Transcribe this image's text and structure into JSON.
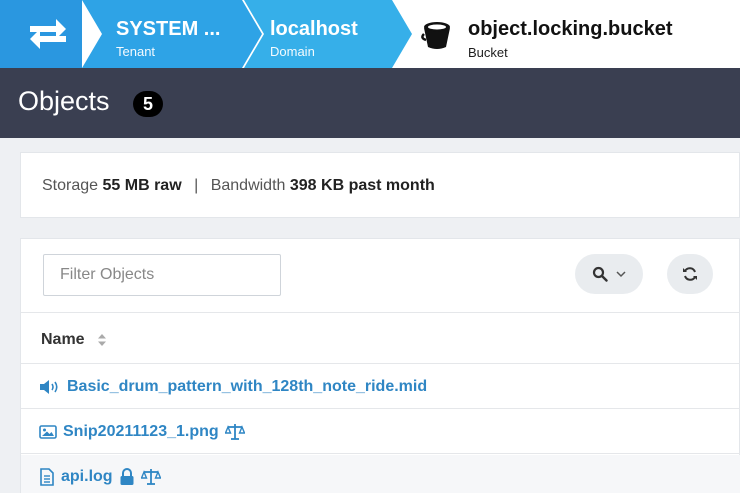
{
  "breadcrumb": {
    "tenant": {
      "title": "SYSTEM ...",
      "sub": "Tenant"
    },
    "domain": {
      "title": "localhost",
      "sub": "Domain"
    },
    "bucket": {
      "title": "object.locking.bucket",
      "sub": "Bucket"
    }
  },
  "header": {
    "title": "Objects",
    "count": "5"
  },
  "stats": {
    "storage_label": "Storage",
    "storage_value": "55 MB raw",
    "separator": "|",
    "bandwidth_label": "Bandwidth",
    "bandwidth_value": "398 KB past month"
  },
  "objects_panel": {
    "filter_placeholder": "Filter Objects",
    "column_name": "Name",
    "rows": [
      {
        "name": "Basic_drum_pattern_with_128th_note_ride.mid",
        "icon": "audio-icon",
        "badges": []
      },
      {
        "name": "Snip20211123_1.png",
        "icon": "image-icon",
        "badges": [
          "legal-hold-icon"
        ]
      },
      {
        "name": "api.log",
        "icon": "file-text-icon",
        "badges": [
          "lock-icon",
          "legal-hold-icon"
        ]
      }
    ]
  },
  "colors": {
    "accent": "#2a97e0",
    "header_bg": "#3a3f51",
    "link": "#2f86c4"
  }
}
